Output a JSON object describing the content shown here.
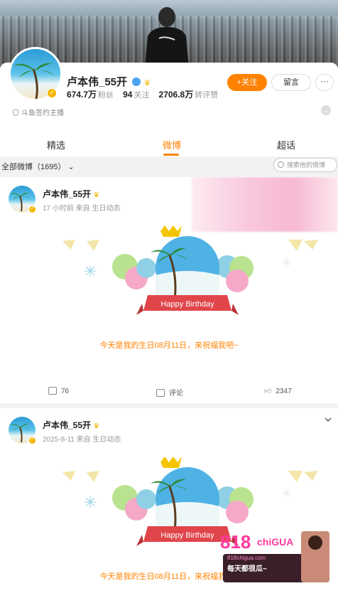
{
  "profile": {
    "name": "卢本伟_55开",
    "followers_value": "674.7万",
    "followers_label": "粉丝",
    "following_value": "94",
    "following_label": "关注",
    "likes_value": "2706.8万",
    "likes_label": "转评赞",
    "follow_button": "+关注",
    "message_button": "留言",
    "more_button": "···",
    "signature": "斗鱼签约主播"
  },
  "tabs": [
    "精选",
    "微博",
    "超话"
  ],
  "active_tab": "微博",
  "filter": {
    "label": "全部微博（1695）",
    "search_placeholder": "搜索他的微博"
  },
  "posts": [
    {
      "author": "卢本伟_55开",
      "meta": "17 小时前  来自 生日动态",
      "banner_text": "Happy Birthday",
      "text": "今天是我的生日08月11日，来祝福我吧~",
      "repost_count": "76",
      "comment_label": "评论",
      "like_count": "2347"
    },
    {
      "author": "卢本伟_55开",
      "meta": "2025-8-11  来自 生日动态",
      "banner_text": "Happy Birthday",
      "text": "今天是我的生日08月11日，来祝福我吧~"
    }
  ],
  "ad": {
    "logo": "818",
    "brand": "chiGUA",
    "domain": "818chigua.com",
    "slogan": "每天都很瓜~"
  },
  "colors": {
    "accent": "#ff8200",
    "verified": "#f5b700",
    "banner_red": "#e0454a"
  }
}
